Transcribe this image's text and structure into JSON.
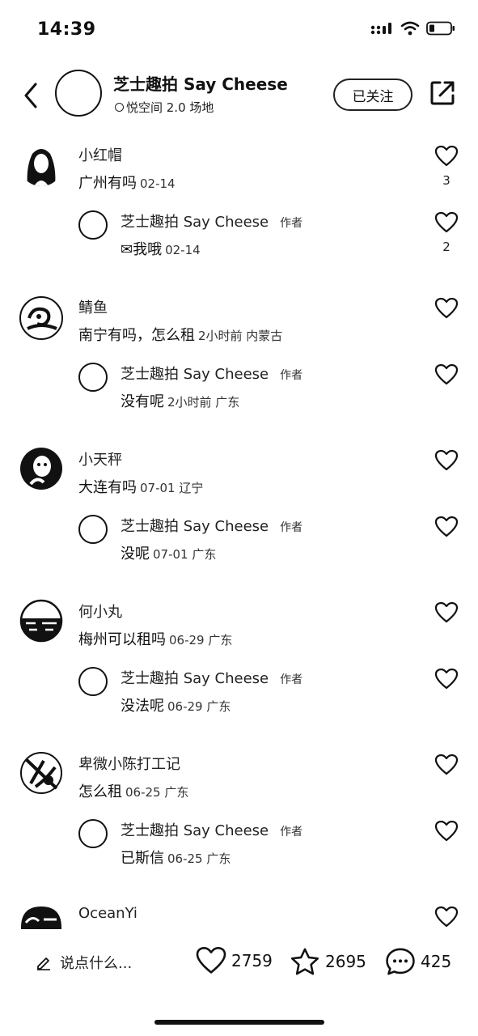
{
  "status_bar": {
    "time": "14:39"
  },
  "header": {
    "title": "芝士趣拍 Say Cheese",
    "subtitle": "悦空间 2.0 场地",
    "follow_label": "已关注"
  },
  "comments": [
    {
      "name": "小红帽",
      "text": "广州有吗",
      "meta": "02-14",
      "likes": "3",
      "reply": {
        "name": "芝士趣拍 Say Cheese",
        "tag": "作者",
        "text": "我哦",
        "emoji": "✉",
        "meta": "02-14",
        "likes": "2"
      }
    },
    {
      "name": "鲭鱼",
      "text": "南宁有吗，怎么租",
      "meta": "2小时前 内蒙古",
      "likes": "",
      "reply": {
        "name": "芝士趣拍 Say Cheese",
        "tag": "作者",
        "text": "没有呢",
        "emoji": "",
        "meta": "2小时前 广东",
        "likes": ""
      }
    },
    {
      "name": "小天秤",
      "text": "大连有吗",
      "meta": "07-01 辽宁",
      "likes": "",
      "reply": {
        "name": "芝士趣拍 Say Cheese",
        "tag": "作者",
        "text": "没呢",
        "emoji": "",
        "meta": "07-01 广东",
        "likes": ""
      }
    },
    {
      "name": "何小丸",
      "text": "梅州可以租吗",
      "meta": "06-29 广东",
      "likes": "",
      "reply": {
        "name": "芝士趣拍 Say Cheese",
        "tag": "作者",
        "text": "没法呢",
        "emoji": "",
        "meta": "06-29 广东",
        "likes": ""
      }
    },
    {
      "name": "卑微小陈打工记",
      "text": "怎么租",
      "meta": "06-25 广东",
      "likes": "",
      "reply": {
        "name": "芝士趣拍 Say Cheese",
        "tag": "作者",
        "text": "已斯信",
        "emoji": "",
        "meta": "06-25 广东",
        "likes": ""
      }
    },
    {
      "name": "OceanYi",
      "text": "",
      "meta": "",
      "likes": ""
    }
  ],
  "bottom_bar": {
    "input_placeholder": "说点什么...",
    "like_count": "2759",
    "collect_count": "2695",
    "comment_count": "425"
  }
}
